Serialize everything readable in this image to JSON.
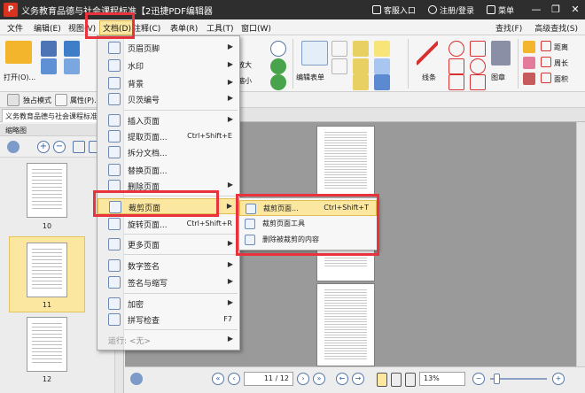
{
  "window": {
    "title": "义务教育品德与社会课程标准【2迅捷PDF编辑器",
    "logo_text": "P",
    "right_items": [
      "客服入口",
      "注册/登录",
      "菜单"
    ],
    "controls": [
      "—",
      "❐",
      "✕"
    ]
  },
  "menubar": {
    "items": [
      "文件",
      "编辑(E)",
      "视图(V)",
      "文档(D)",
      "注释(C)",
      "表单(R)",
      "工具(T)",
      "窗口(W)"
    ],
    "right": [
      "查找(F)",
      "高级查找(S)"
    ]
  },
  "toolbar": {
    "open_label": "打开(O)...",
    "zoom_large": "放大",
    "zoom_small": "缩小",
    "edit_form": "编辑表单",
    "line": "线条",
    "chapter": "图章",
    "distance": "距离",
    "perimeter": "周长",
    "area": "面积"
  },
  "row2": {
    "solo_mode": "独占模式",
    "properties": "属性(P)..."
  },
  "tab": {
    "doc_title": "义务教育品德与社会课程标准..."
  },
  "thumbnails": {
    "panel_title": "缩略图",
    "pages": [
      "10",
      "11",
      "12"
    ]
  },
  "status": {
    "page_value": "11",
    "page_total": "/ 12",
    "zoom_value": "13%"
  },
  "doc_menu": {
    "items": [
      {
        "label": "页眉页脚",
        "shortcut": "",
        "arrow": true
      },
      {
        "label": "水印",
        "shortcut": "",
        "arrow": true
      },
      {
        "label": "背景",
        "shortcut": "",
        "arrow": true
      },
      {
        "label": "贝茨编号",
        "shortcut": "",
        "arrow": true
      },
      {
        "label": "插入页面",
        "shortcut": "",
        "arrow": true
      },
      {
        "label": "提取页面...",
        "shortcut": "Ctrl+Shift+E",
        "arrow": false
      },
      {
        "label": "拆分文档...",
        "shortcut": "",
        "arrow": false
      },
      {
        "label": "替换页面...",
        "shortcut": "",
        "arrow": false
      },
      {
        "label": "删除页面",
        "shortcut": "",
        "arrow": true
      },
      {
        "label": "裁剪页面",
        "shortcut": "",
        "arrow": true
      },
      {
        "label": "旋转页面...",
        "shortcut": "Ctrl+Shift+R",
        "arrow": false
      },
      {
        "label": "更多页面",
        "shortcut": "",
        "arrow": true
      },
      {
        "label": "数字签名",
        "shortcut": "",
        "arrow": true
      },
      {
        "label": "签名与缩写",
        "shortcut": "",
        "arrow": true
      },
      {
        "label": "加密",
        "shortcut": "",
        "arrow": true
      },
      {
        "label": "拼写检查",
        "shortcut": "F7",
        "arrow": false
      },
      {
        "label": "运行: <无>",
        "shortcut": "",
        "arrow": true
      }
    ]
  },
  "crop_submenu": {
    "items": [
      {
        "label": "裁剪页面...",
        "shortcut": "Ctrl+Shift+T"
      },
      {
        "label": "裁剪页面工具",
        "shortcut": ""
      },
      {
        "label": "删除被裁剪的内容",
        "shortcut": ""
      }
    ]
  },
  "colors": {
    "highlight": "#fbe7a0",
    "annotation_red": "#e8323c",
    "title_bar": "#2e2e2e"
  }
}
